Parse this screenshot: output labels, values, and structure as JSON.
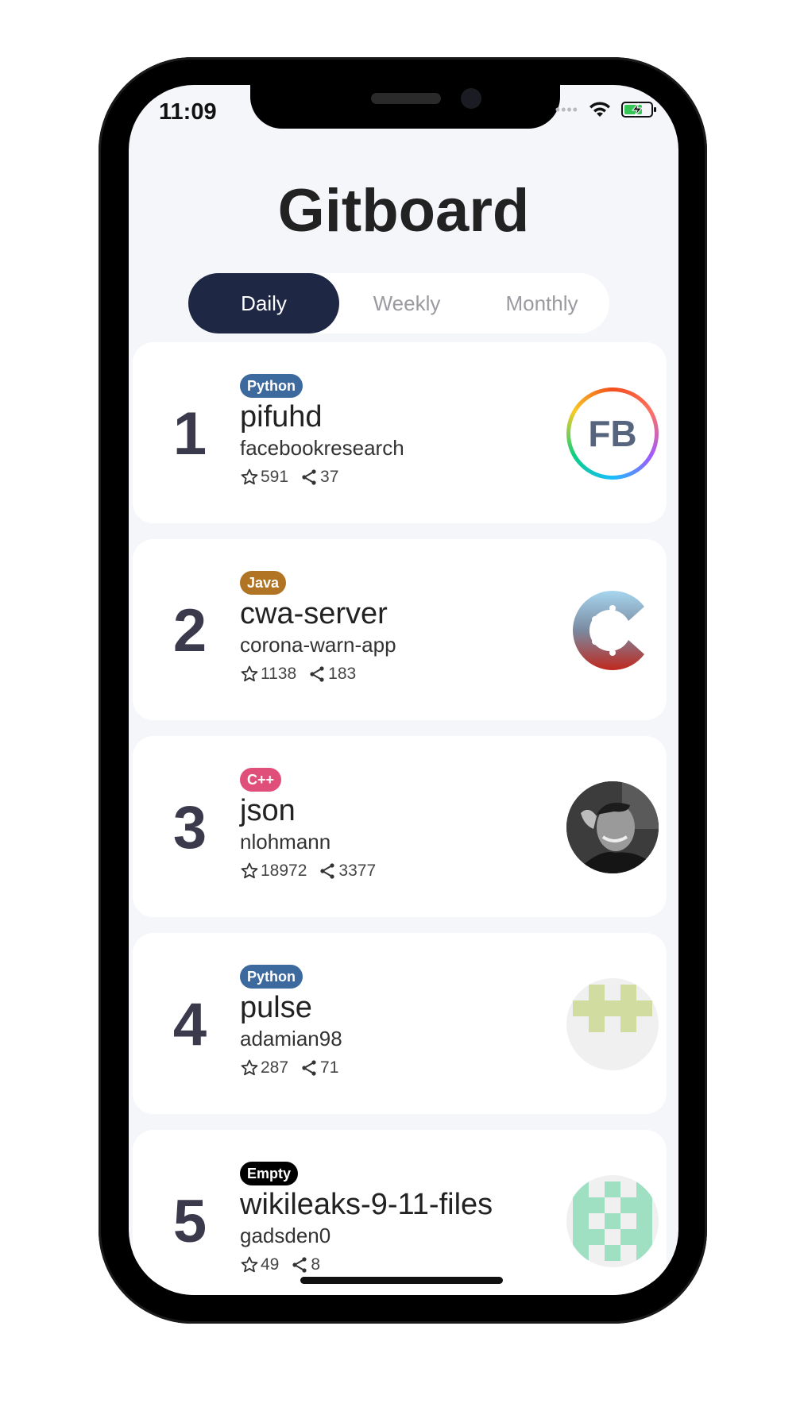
{
  "status": {
    "time": "11:09"
  },
  "header": {
    "title": "Gitboard"
  },
  "tabs": [
    {
      "label": "Daily",
      "active": true
    },
    {
      "label": "Weekly",
      "active": false
    },
    {
      "label": "Monthly",
      "active": false
    }
  ],
  "repos": [
    {
      "rank": "1",
      "language": "Python",
      "lang_color": "#3d6a9e",
      "name": "pifuhd",
      "owner": "facebookresearch",
      "stars": "591",
      "forks": "37",
      "avatar": "fb-logo",
      "avatar_text": "FB"
    },
    {
      "rank": "2",
      "language": "Java",
      "lang_color": "#b07424",
      "name": "cwa-server",
      "owner": "corona-warn-app",
      "stars": "1138",
      "forks": "183",
      "avatar": "corona-warn-app-logo"
    },
    {
      "rank": "3",
      "language": "C++",
      "lang_color": "#e04f7a",
      "name": "json",
      "owner": "nlohmann",
      "stars": "18972",
      "forks": "3377",
      "avatar": "user-photo"
    },
    {
      "rank": "4",
      "language": "Python",
      "lang_color": "#3d6a9e",
      "name": "pulse",
      "owner": "adamian98",
      "stars": "287",
      "forks": "71",
      "avatar": "identicon-green"
    },
    {
      "rank": "5",
      "language": "Empty",
      "lang_color": "#000000",
      "name": "wikileaks-9-11-files",
      "owner": "gadsden0",
      "stars": "49",
      "forks": "8",
      "avatar": "identicon-mint"
    }
  ]
}
